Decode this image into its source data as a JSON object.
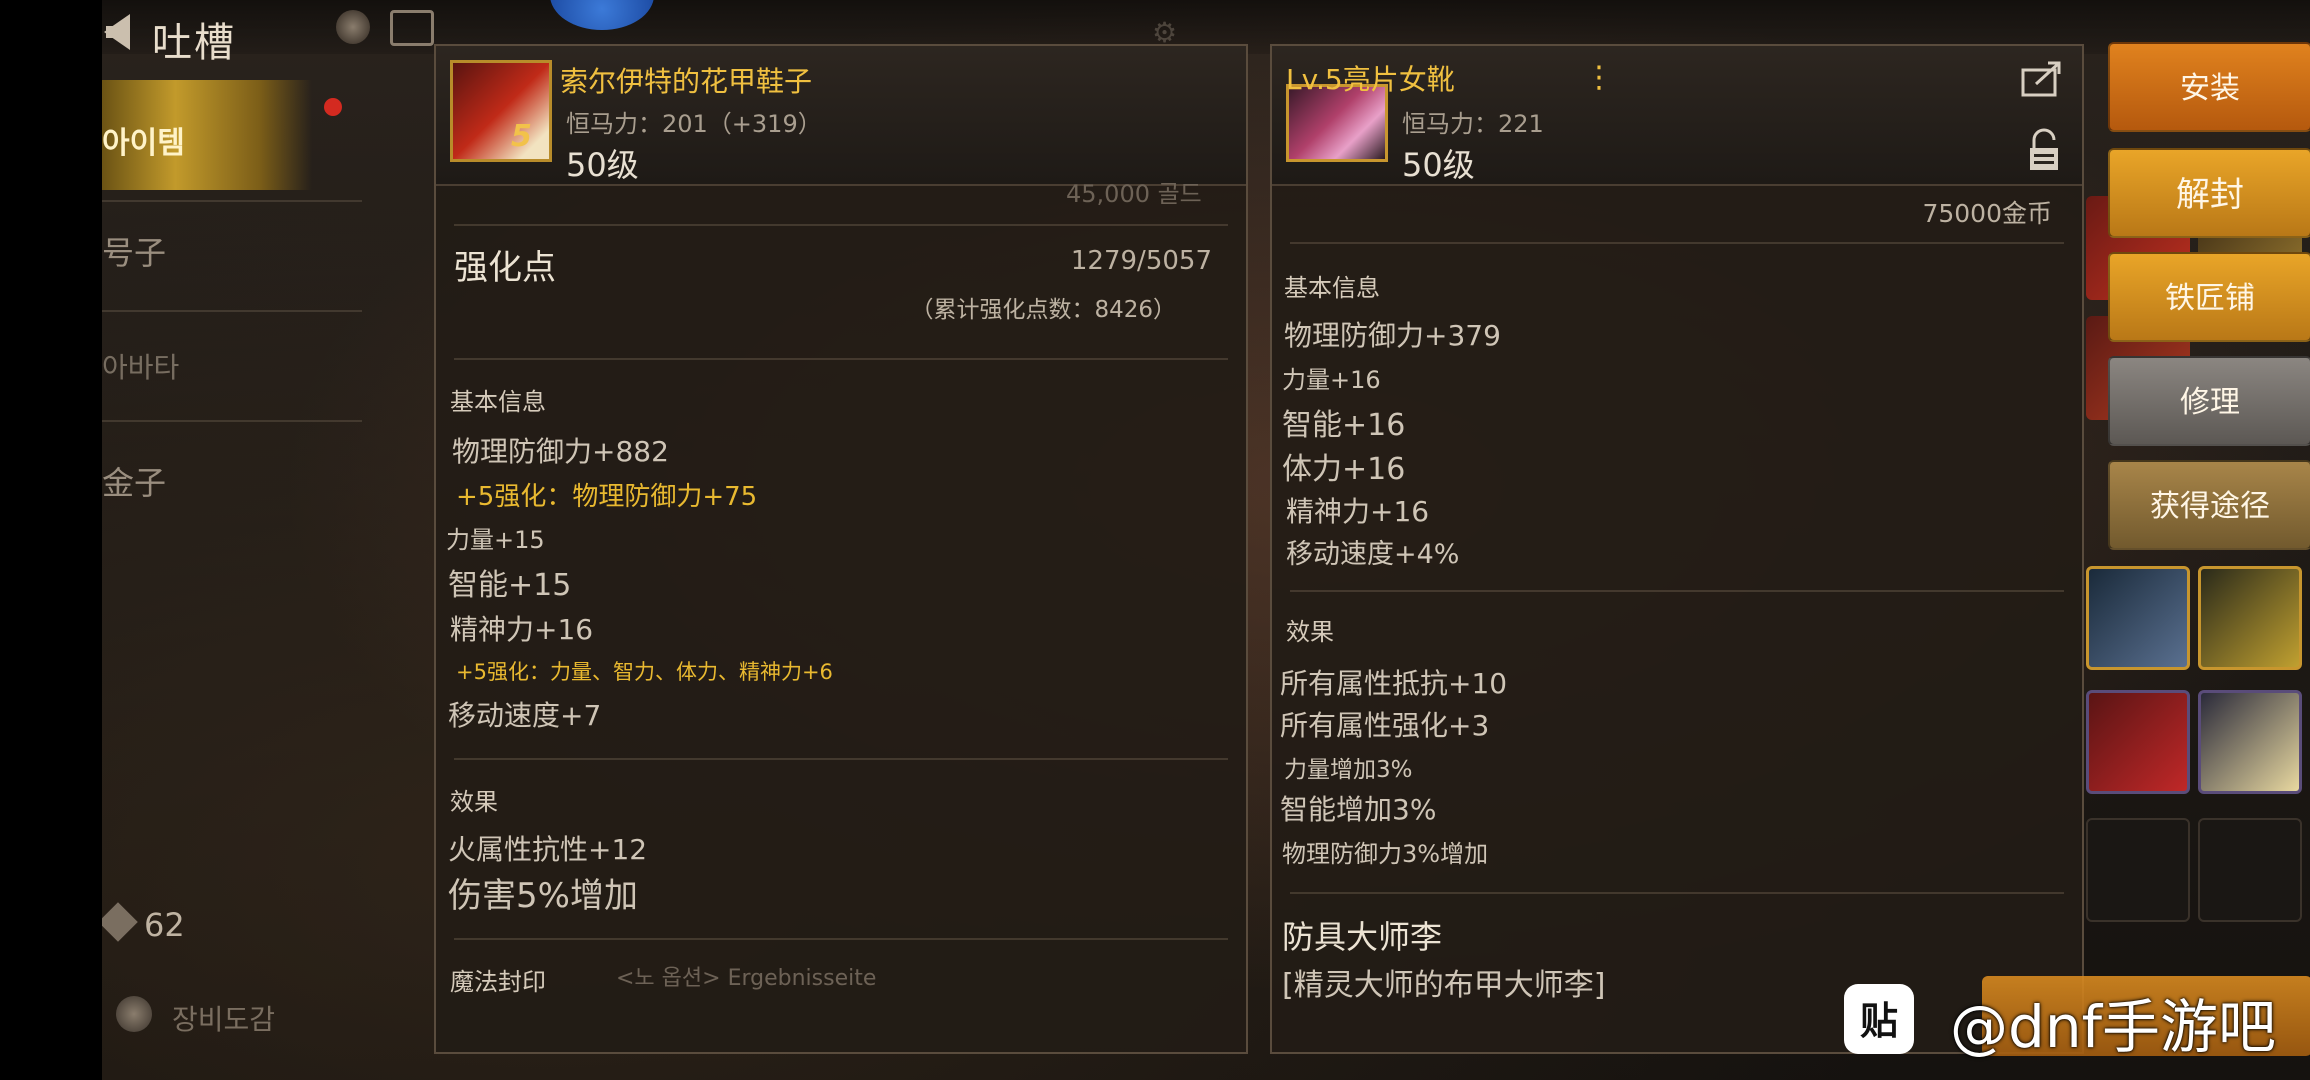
{
  "header": {
    "title": "吐槽",
    "back_icon": "back-arrow-icon"
  },
  "sidebar": {
    "active_label": "아이템",
    "items": [
      {
        "label": "号子"
      },
      {
        "label": "아바타"
      },
      {
        "label": "金子"
      }
    ],
    "count": "62",
    "bottom_label": "장비도감"
  },
  "left_item": {
    "name": "索尔伊特的花甲鞋子",
    "stat_line": "恒马力：201（+319）",
    "level": "50级",
    "enhance_badge": "5",
    "top_partial": "45,000 골드",
    "enhance_points_label": "强化点",
    "enhance_points_value": "1279/5057",
    "enhance_points_total": "（累计强化点数：8426）",
    "basic_title": "基本信息",
    "stats": [
      {
        "text": "物理防御力+882",
        "style": "normal"
      },
      {
        "text": "+5强化：物理防御力+75",
        "style": "gold"
      },
      {
        "text": "力量+15",
        "style": "small"
      },
      {
        "text": "智能+15",
        "style": "large"
      },
      {
        "text": "精神力+16",
        "style": "normal"
      },
      {
        "text": "+5强化：力量、智力、体力、精神力+6",
        "style": "gold-small"
      },
      {
        "text": "移动速度+7",
        "style": "normal"
      }
    ],
    "effect_title": "效果",
    "effects": [
      {
        "text": "火属性抗性+12",
        "style": "normal"
      },
      {
        "text": "伤害5%增加",
        "style": "large"
      }
    ],
    "seal_title": "魔法封印",
    "seal_partial": "<노 옵션> Ergebnisseite"
  },
  "right_item": {
    "name": "Lv.5亮片女靴",
    "stat_line": "恒马力：221",
    "level": "50级",
    "price": "75000金币",
    "basic_title": "基本信息",
    "stats": [
      {
        "text": "物理防御力+379",
        "style": "normal"
      },
      {
        "text": "力量+16",
        "style": "small"
      },
      {
        "text": "智能+16",
        "style": "large"
      },
      {
        "text": "体力+16",
        "style": "large"
      },
      {
        "text": "精神力+16",
        "style": "normal"
      },
      {
        "text": "移动速度+4%",
        "style": "normal"
      }
    ],
    "effect_title": "效果",
    "effects": [
      {
        "text": "所有属性抵抗+10",
        "style": "normal"
      },
      {
        "text": "所有属性强化+3",
        "style": "normal"
      },
      {
        "text": "力量增加3%",
        "style": "small"
      },
      {
        "text": "智能增加3%",
        "style": "normal"
      },
      {
        "text": "物理防御力3%增加",
        "style": "small"
      }
    ],
    "set_title": "防具大师李",
    "set_name": "[精灵大师的布甲大师李]"
  },
  "buttons": {
    "install": "安装",
    "unseal": "解封",
    "blacksmith": "铁匠铺",
    "repair": "修理",
    "obtain": "获得途径"
  },
  "watermark": {
    "logo": "贴",
    "text": "@dnf手游吧"
  },
  "colors": {
    "gold_text": "#e9b930",
    "install_button": "#e0821e",
    "unseal_button": "#e9a528",
    "repair_button": "#8b8681",
    "obtain_button": "#a88549"
  }
}
